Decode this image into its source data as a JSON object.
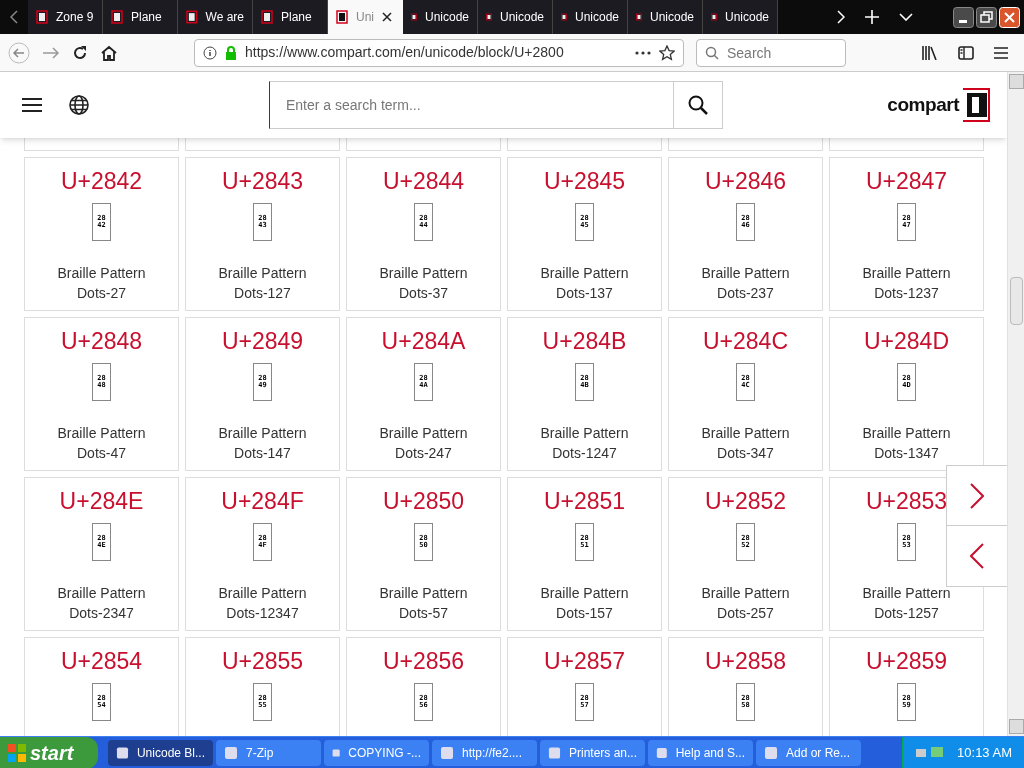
{
  "tabs": [
    {
      "label": "Zone 9",
      "selected": false
    },
    {
      "label": "Plane",
      "selected": false
    },
    {
      "label": "We are",
      "selected": false
    },
    {
      "label": "Plane",
      "selected": false
    },
    {
      "label": "Uni",
      "selected": true
    },
    {
      "label": "Unicode",
      "selected": false
    },
    {
      "label": "Unicode",
      "selected": false
    },
    {
      "label": "Unicode",
      "selected": false
    },
    {
      "label": "Unicode",
      "selected": false
    },
    {
      "label": "Unicode",
      "selected": false
    }
  ],
  "address": "https://www.compart.com/en/unicode/block/U+2800",
  "browser_search": {
    "placeholder": "Search"
  },
  "site_search": {
    "placeholder": "Enter a search term..."
  },
  "logo": "compart",
  "cards": [
    {
      "code": "U+2842",
      "hex": [
        "28",
        "42"
      ],
      "name": "Braille Pattern Dots-27"
    },
    {
      "code": "U+2843",
      "hex": [
        "28",
        "43"
      ],
      "name": "Braille Pattern Dots-127"
    },
    {
      "code": "U+2844",
      "hex": [
        "28",
        "44"
      ],
      "name": "Braille Pattern Dots-37"
    },
    {
      "code": "U+2845",
      "hex": [
        "28",
        "45"
      ],
      "name": "Braille Pattern Dots-137"
    },
    {
      "code": "U+2846",
      "hex": [
        "28",
        "46"
      ],
      "name": "Braille Pattern Dots-237"
    },
    {
      "code": "U+2847",
      "hex": [
        "28",
        "47"
      ],
      "name": "Braille Pattern Dots-1237"
    },
    {
      "code": "U+2848",
      "hex": [
        "28",
        "48"
      ],
      "name": "Braille Pattern Dots-47"
    },
    {
      "code": "U+2849",
      "hex": [
        "28",
        "49"
      ],
      "name": "Braille Pattern Dots-147"
    },
    {
      "code": "U+284A",
      "hex": [
        "28",
        "4A"
      ],
      "name": "Braille Pattern Dots-247"
    },
    {
      "code": "U+284B",
      "hex": [
        "28",
        "4B"
      ],
      "name": "Braille Pattern Dots-1247"
    },
    {
      "code": "U+284C",
      "hex": [
        "28",
        "4C"
      ],
      "name": "Braille Pattern Dots-347"
    },
    {
      "code": "U+284D",
      "hex": [
        "28",
        "4D"
      ],
      "name": "Braille Pattern Dots-1347"
    },
    {
      "code": "U+284E",
      "hex": [
        "28",
        "4E"
      ],
      "name": "Braille Pattern Dots-2347"
    },
    {
      "code": "U+284F",
      "hex": [
        "28",
        "4F"
      ],
      "name": "Braille Pattern Dots-12347"
    },
    {
      "code": "U+2850",
      "hex": [
        "28",
        "50"
      ],
      "name": "Braille Pattern Dots-57"
    },
    {
      "code": "U+2851",
      "hex": [
        "28",
        "51"
      ],
      "name": "Braille Pattern Dots-157"
    },
    {
      "code": "U+2852",
      "hex": [
        "28",
        "52"
      ],
      "name": "Braille Pattern Dots-257"
    },
    {
      "code": "U+2853",
      "hex": [
        "28",
        "53"
      ],
      "name": "Braille Pattern Dots-1257"
    },
    {
      "code": "U+2854",
      "hex": [
        "28",
        "54"
      ]
    },
    {
      "code": "U+2855",
      "hex": [
        "28",
        "55"
      ]
    },
    {
      "code": "U+2856",
      "hex": [
        "28",
        "56"
      ]
    },
    {
      "code": "U+2857",
      "hex": [
        "28",
        "57"
      ]
    },
    {
      "code": "U+2858",
      "hex": [
        "28",
        "58"
      ]
    },
    {
      "code": "U+2859",
      "hex": [
        "28",
        "59"
      ]
    }
  ],
  "taskbar": {
    "start": "start",
    "items": [
      {
        "label": "Unicode Bl...",
        "selected": true
      },
      {
        "label": "7-Zip",
        "selected": false
      },
      {
        "label": "COPYING -...",
        "selected": false
      },
      {
        "label": "http://fe2....",
        "selected": false
      },
      {
        "label": "Printers an...",
        "selected": false
      },
      {
        "label": "Help and S...",
        "selected": false
      },
      {
        "label": "Add or Re...",
        "selected": false
      }
    ],
    "clock": "10:13 AM"
  }
}
